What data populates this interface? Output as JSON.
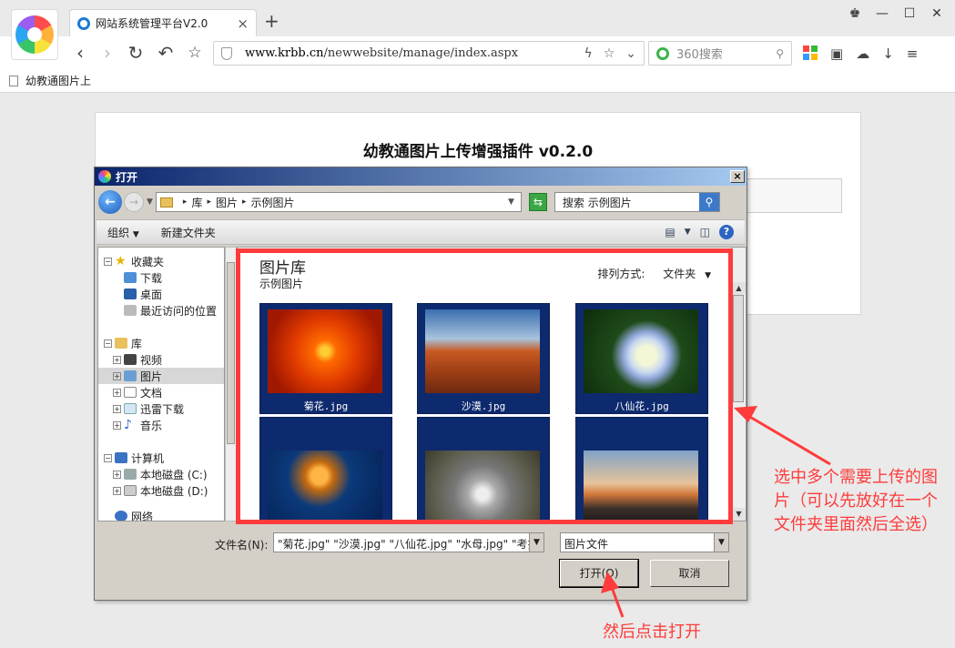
{
  "browser": {
    "tab_title": "网站系统管理平台V2.0",
    "tab_close": "×",
    "new_tab": "+",
    "url_domain": "www.krbb.cn",
    "url_path": "/newwebsite/manage/index.aspx",
    "search_placeholder": "360搜索",
    "bookmark_label": "幼教通图片上"
  },
  "page": {
    "title": "幼教通图片上传增强插件 v0.2.0"
  },
  "dialog": {
    "title": "打开",
    "close": "×",
    "breadcrumb": [
      "库",
      "图片",
      "示例图片"
    ],
    "search_placeholder": "搜索 示例图片",
    "organize": "组织",
    "new_folder": "新建文件夹",
    "tree": {
      "favorites": "收藏夹",
      "downloads": "下载",
      "desktop": "桌面",
      "recent": "最近访问的位置",
      "libraries": "库",
      "videos": "视频",
      "pictures": "图片",
      "documents": "文档",
      "thunder": "迅雷下载",
      "music": "音乐",
      "computer": "计算机",
      "disk_c": "本地磁盘 (C:)",
      "disk_d": "本地磁盘 (D:)",
      "network": "网络"
    },
    "library_title": "图片库",
    "library_sub": "示例图片",
    "sort_label": "排列方式:",
    "sort_value": "文件夹",
    "files": [
      {
        "name": "菊花.jpg"
      },
      {
        "name": "沙漠.jpg"
      },
      {
        "name": "八仙花.jpg"
      },
      {
        "name": ""
      },
      {
        "name": ""
      },
      {
        "name": ""
      }
    ],
    "filename_label": "文件名(N):",
    "filename_value": "\"菊花.jpg\" \"沙漠.jpg\" \"八仙花.jpg\" \"水母.jpg\" \"考拉",
    "filetype_value": "图片文件",
    "open_button": "打开(O)",
    "cancel_button": "取消"
  },
  "annotations": {
    "select_note": "选中多个需要上传的图片（可以先放好在一个文件夹里面然后全选）",
    "open_note": "然后点击打开",
    "color": "#ff3b3b"
  }
}
